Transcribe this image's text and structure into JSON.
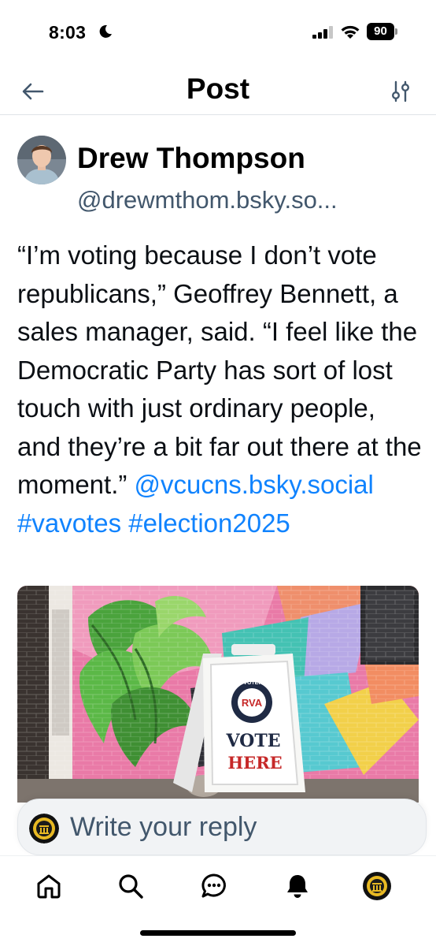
{
  "status_bar": {
    "time": "8:03",
    "battery": "90"
  },
  "header": {
    "title": "Post"
  },
  "post": {
    "author_name": "Drew Thompson",
    "author_handle": "@drewmthom.bsky.so...",
    "text_quote": "“I’m voting because I don’t vote republicans,” Geoffrey Bennett, a sales manager, said. “I feel like the Democratic Party has sort of lost touch with just ordinary people, and they’re a bit far out there at the moment.” ",
    "mention": "@vcucns.bsky.social",
    "tag_1": "#vavotes",
    "tag_2": "#election2025",
    "image_sign": {
      "top_text": "VOTE!",
      "logo_text": "RVA",
      "ring_text": "OFFICE OF ELECTIONS",
      "line_1": "VOTE",
      "line_2": "HERE"
    }
  },
  "reply": {
    "placeholder": "Write your reply"
  },
  "colors": {
    "link": "#1083fe",
    "muted": "#42576c",
    "divider": "#dfe3e8"
  },
  "nav": [
    "home-icon",
    "search-icon",
    "chat-icon",
    "bell-icon",
    "profile-avatar"
  ]
}
